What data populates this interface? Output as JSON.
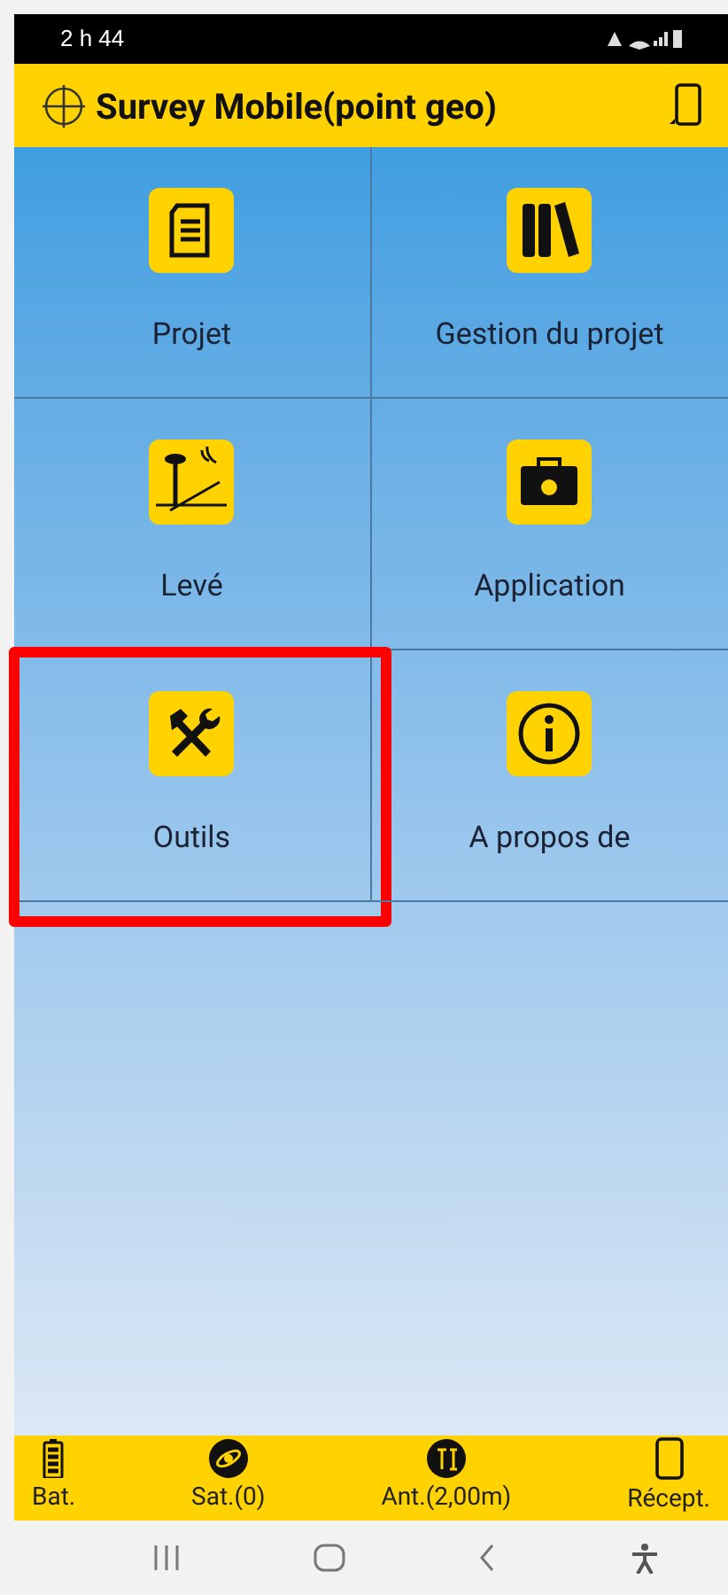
{
  "status_bar": {
    "time": "2 h 44"
  },
  "app_bar": {
    "title": "Survey Mobile(point geo)"
  },
  "tiles": [
    {
      "kind": "project",
      "label": "Projet",
      "highlighted": false
    },
    {
      "kind": "manage",
      "label": "Gestion du projet",
      "highlighted": false
    },
    {
      "kind": "survey",
      "label": "Levé",
      "highlighted": false
    },
    {
      "kind": "application",
      "label": "Application",
      "highlighted": false
    },
    {
      "kind": "tools",
      "label": "Outils",
      "highlighted": true
    },
    {
      "kind": "about",
      "label": "A propos de",
      "highlighted": false
    }
  ],
  "bottom_bar": [
    {
      "kind": "battery",
      "label": "Bat."
    },
    {
      "kind": "satellite",
      "label": "Sat.(0)"
    },
    {
      "kind": "antenna",
      "label": "Ant.(2,00m)"
    },
    {
      "kind": "receiver",
      "label": "Récept."
    }
  ]
}
